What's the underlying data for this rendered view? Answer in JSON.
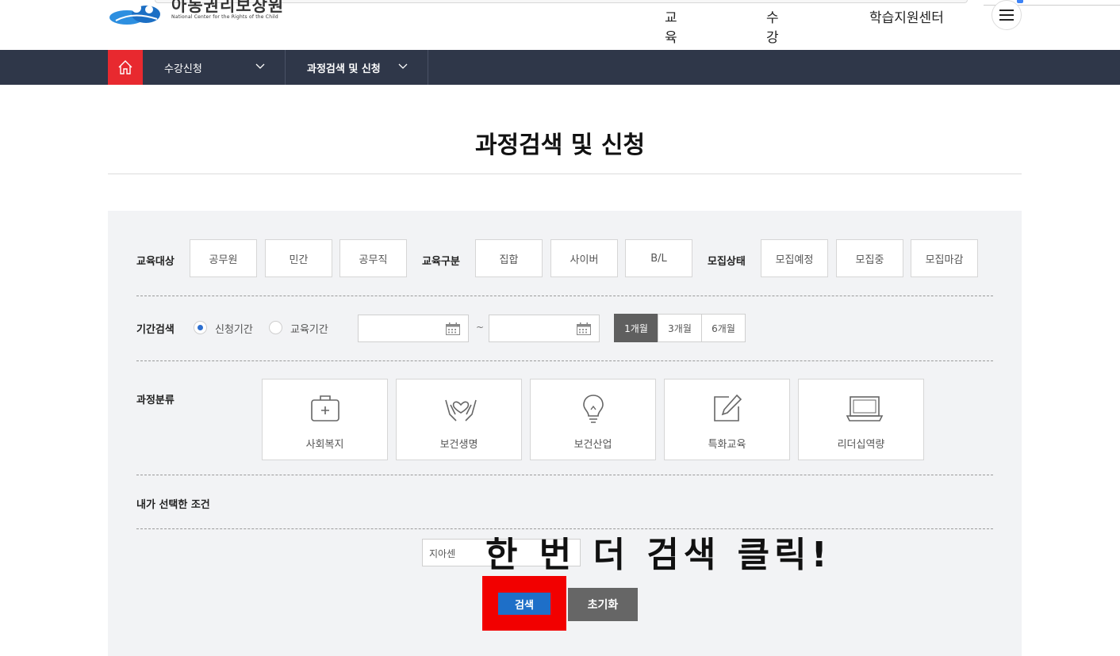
{
  "header": {
    "logo_ko": "아동권리보장원",
    "logo_en": "National Center for the Rights of the Child",
    "gnb": [
      "교육소개",
      "수강신청",
      "학습지원센터"
    ]
  },
  "nav": {
    "item1": "수강신청",
    "item2": "과정검색 및 신청"
  },
  "page": {
    "title": "과정검색 및 신청"
  },
  "filters": {
    "target_label": "교육대상",
    "targets": [
      "공무원",
      "민간",
      "공무직"
    ],
    "type_label": "교육구분",
    "types": [
      "집합",
      "사이버",
      "B/L"
    ],
    "status_label": "모집상태",
    "statuses": [
      "모집예정",
      "모집중",
      "모집마감"
    ],
    "period_label": "기간검색",
    "radio_apply": "신청기간",
    "radio_edu": "교육기간",
    "tilde": "~",
    "periods": [
      "1개월",
      "3개월",
      "6개월"
    ],
    "category_label": "과정분류",
    "categories": [
      "사회복지",
      "보건생명",
      "보건산업",
      "특화교육",
      "리더십역량"
    ],
    "selected_label": "내가 선택한 조건",
    "keyword_value": "지아센"
  },
  "actions": {
    "search": "검색",
    "reset": "초기화"
  },
  "annotation": {
    "text": "한 번 더 검색 클릭!"
  },
  "colors": {
    "navbar": "#2f3749",
    "home": "#e8292f",
    "search": "#1e6fc8",
    "highlight": "#f20000"
  }
}
